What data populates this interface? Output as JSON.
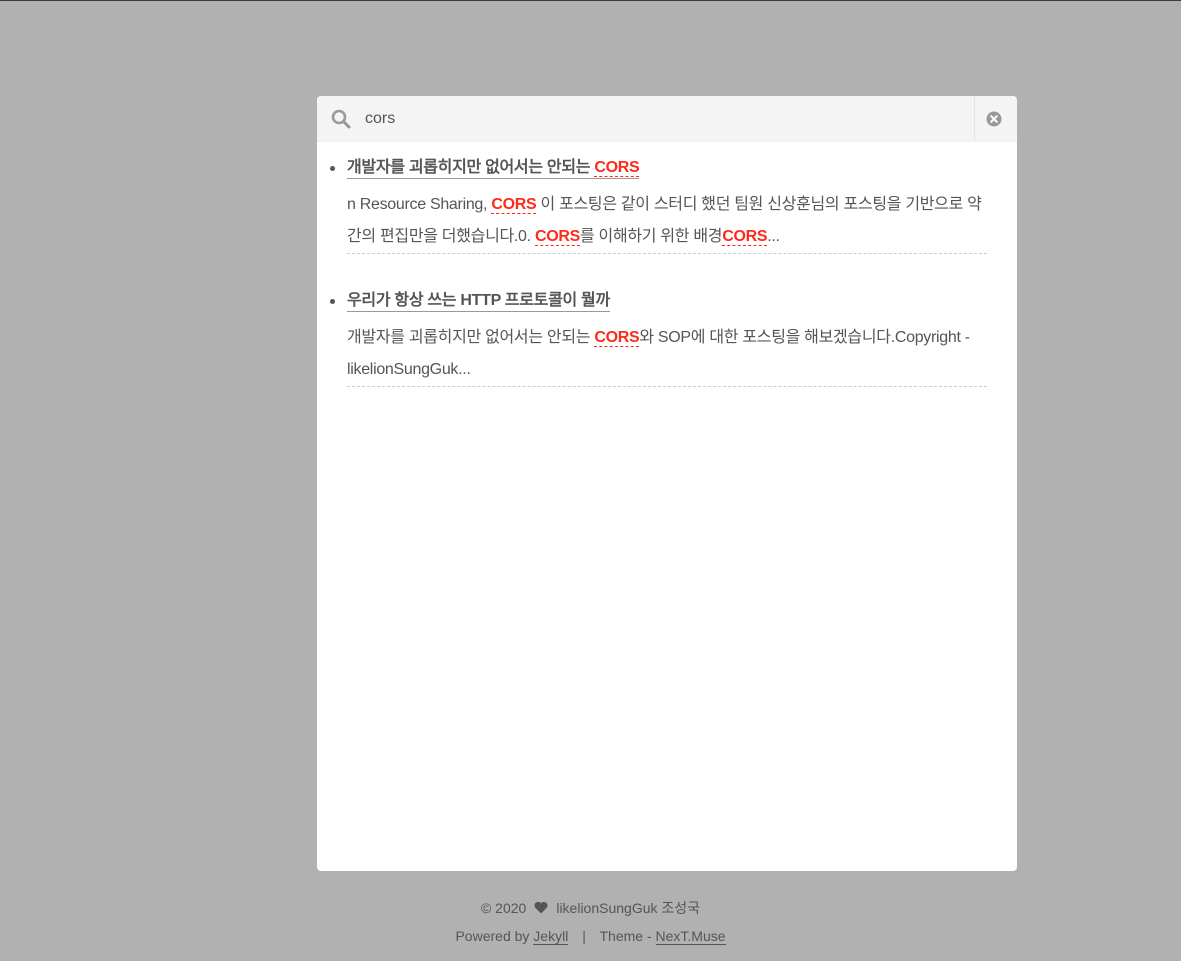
{
  "search": {
    "value": "cors",
    "placeholder": ""
  },
  "results": [
    {
      "title_before": "개발자를 괴롭히지만 없어서는 안되는 ",
      "title_highlight": "CORS",
      "excerpt_1": "n Resource Sharing, ",
      "excerpt_hl_1": "CORS",
      "excerpt_2": " 이 포스팅은 같이 스터디 했던 팀원 신상훈님의 포스팅을 기반으로 약간의 편집만을 더했습니다.0. ",
      "excerpt_hl_2": "CORS",
      "excerpt_3": "를 이해하기 위한 배경",
      "excerpt_hl_3": "CORS",
      "excerpt_4": "..."
    },
    {
      "title": "우리가 항상 쓰는 HTTP 프로토콜이 뭘까",
      "excerpt_1": "개발자를 괴롭히지만 없어서는 안되는 ",
      "excerpt_hl_1": "CORS",
      "excerpt_2": "와 SOP에 대한 포스팅을 해보겠습니다.Copyright - likelionSungGuk..."
    }
  ],
  "footer": {
    "copyright": "© 2020",
    "author": "likelionSungGuk 조성국",
    "powered_by": "Powered by",
    "jekyll": "Jekyll",
    "separator": "|",
    "theme_label": "Theme -",
    "theme": "NexT.Muse"
  },
  "icons": {
    "search": "search-icon",
    "close": "close-icon",
    "heart": "heart-icon"
  },
  "colors": {
    "overlay": "#b1b1b1",
    "highlight": "#ff2a1a",
    "text": "#555555"
  }
}
